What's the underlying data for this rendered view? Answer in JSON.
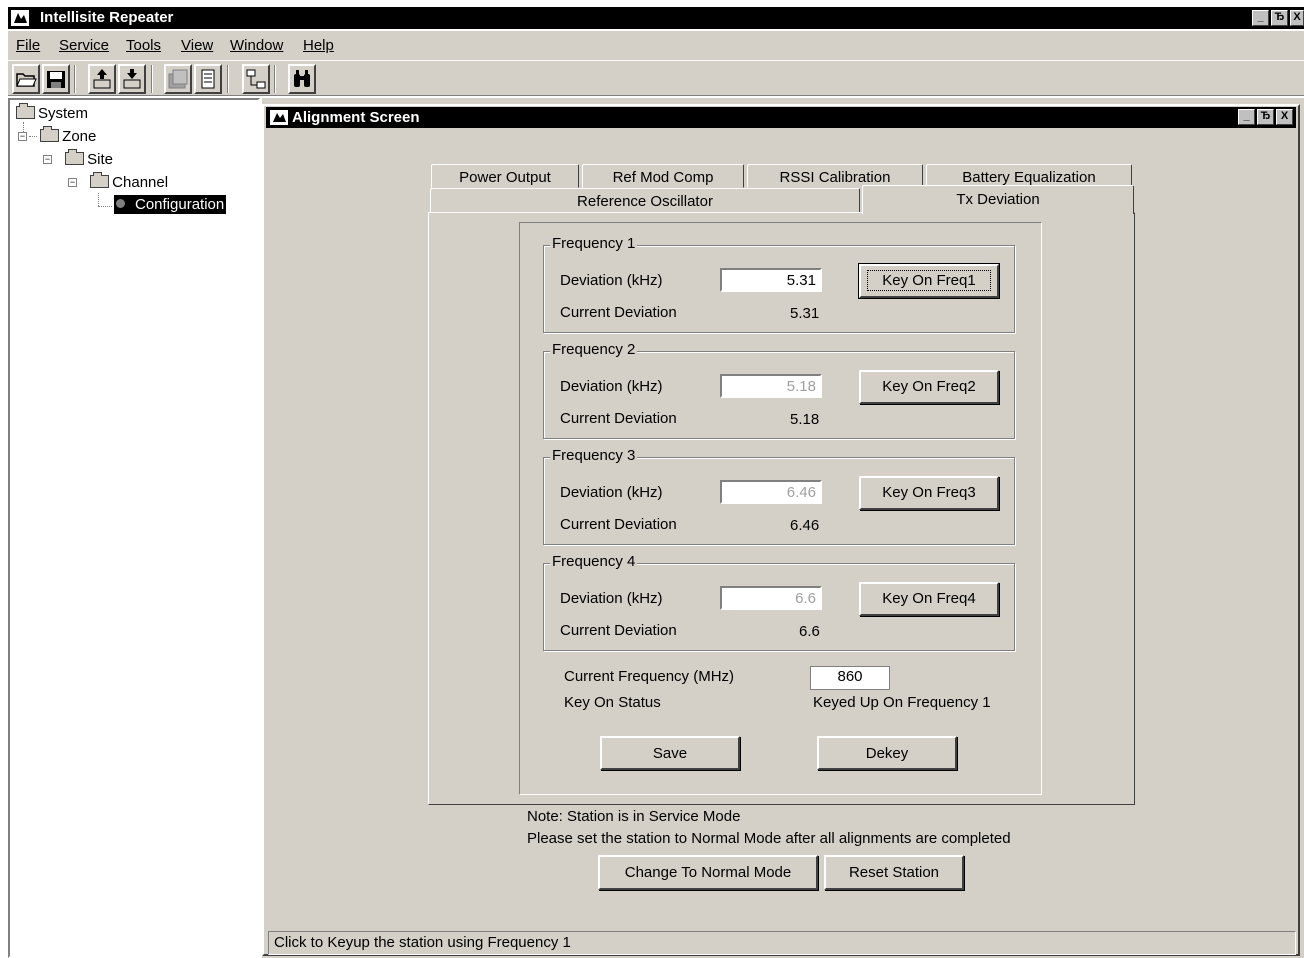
{
  "app": {
    "title": "Intellisite Repeater"
  },
  "window_controls": {
    "minimize": "_",
    "restore": "Ђ",
    "close": "X"
  },
  "menu": [
    {
      "label": "File"
    },
    {
      "label": "Service"
    },
    {
      "label": "Tools"
    },
    {
      "label": "View"
    },
    {
      "label": "Window"
    },
    {
      "label": "Help"
    }
  ],
  "toolbar": {
    "buttons": [
      "open-icon",
      "save-icon",
      "upload-icon",
      "download-icon",
      "report-icon",
      "page-icon",
      "network-icon",
      "binoculars-icon"
    ]
  },
  "tree": {
    "system": "System",
    "zone": "Zone",
    "site": "Site",
    "channel": "Channel",
    "configuration": "Configuration",
    "expander": "−"
  },
  "alignment": {
    "title": "Alignment Screen",
    "tabs_back": [
      "Power Output",
      "Ref Mod Comp",
      "RSSI Calibration",
      "Battery Equalization"
    ],
    "tabs_front": [
      "Reference Oscillator",
      "Tx Deviation"
    ],
    "active_tab": "Tx Deviation",
    "deviation_label": "Deviation (kHz)",
    "current_deviation_label": "Current Deviation",
    "frequencies": [
      {
        "title": "Frequency 1",
        "deviation": "5.31",
        "current": "5.31",
        "button": "Key On Freq1"
      },
      {
        "title": "Frequency 2",
        "deviation": "5.18",
        "current": "5.18",
        "button": "Key On Freq2"
      },
      {
        "title": "Frequency 3",
        "deviation": "6.46",
        "current": "6.46",
        "button": "Key On Freq3"
      },
      {
        "title": "Frequency 4",
        "deviation": "6.6",
        "current": "6.6",
        "button": "Key On Freq4"
      }
    ],
    "current_frequency_label": "Current Frequency (MHz)",
    "current_frequency_value": "860",
    "key_on_status_label": "Key On Status",
    "key_on_status_value": "Keyed Up On  Frequency 1",
    "save_button": "Save",
    "dekey_button": "Dekey",
    "note_line1": "Note: Station is in Service Mode",
    "note_line2": "Please set the station to Normal Mode after all alignments are completed",
    "normal_mode_button": "Change To Normal Mode",
    "reset_button": "Reset Station"
  },
  "status_bar": {
    "text": "Click to Keyup the station using Frequency 1"
  }
}
